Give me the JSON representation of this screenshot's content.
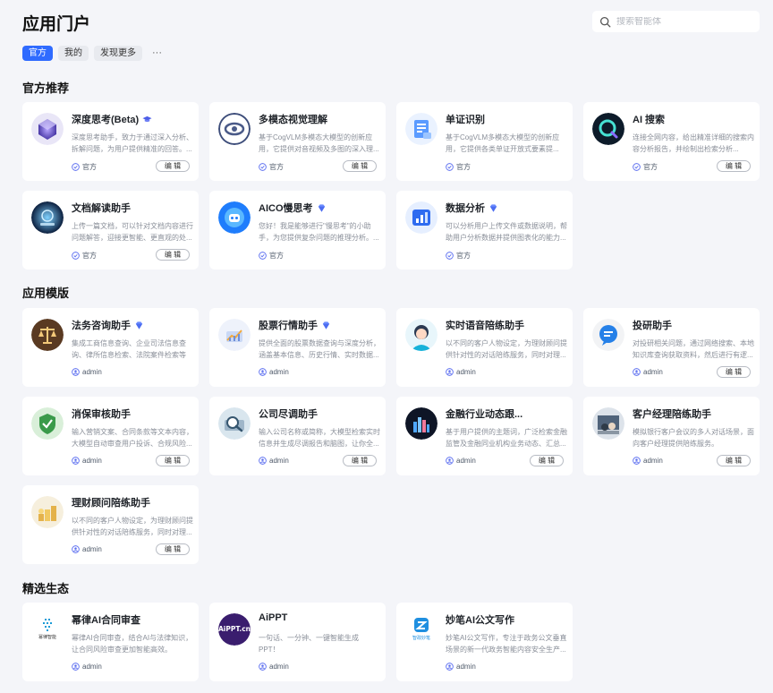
{
  "header": {
    "title": "应用门户",
    "search_placeholder": "搜索智能体"
  },
  "tabs": [
    {
      "label": "官方",
      "active": true
    },
    {
      "label": "我的",
      "active": false
    },
    {
      "label": "发现更多",
      "active": false
    }
  ],
  "tabs_more": "···",
  "sections": {
    "official": {
      "title": "官方推荐",
      "cards": [
        {
          "title": "深度思考(Beta)",
          "desc": "深度思考助手，致力于通过深入分析、拆解问题，为用户提供精准的回答。...",
          "owner": "官方",
          "edit": "编 辑",
          "badge": "cap"
        },
        {
          "title": "多模态视觉理解",
          "desc": "基于CogVLM多模态大模型的创新应用，它提供对音视频及多图的深入理...",
          "owner": "官方",
          "edit": "编 辑"
        },
        {
          "title": "单证识别",
          "desc": "基于CogVLM多模态大模型的创新应用，它提供各类单证开放式要素提...",
          "owner": "官方"
        },
        {
          "title": "AI 搜索",
          "desc": "连接全网内容，给出精准详细的搜索内容分析报告，并绘制出检索分析...",
          "owner": "官方",
          "edit": "编 辑"
        },
        {
          "title": "文档解读助手",
          "desc": "上传一篇文档，可以针对文档内容进行问题解答，迎接更智能、更直观的处...",
          "owner": "官方",
          "edit": "编 辑"
        },
        {
          "title": "AICO慢思考",
          "desc": "您好！我是能够进行\"慢思考\"的小助手，为您提供复杂问题的推理分析。...",
          "owner": "官方",
          "badge": "diamond"
        },
        {
          "title": "数据分析",
          "desc": "可以分析用户上传文件或数据说明，帮助用户分析数据并提供图表化的能力...",
          "owner": "官方",
          "badge": "diamond"
        }
      ]
    },
    "templates": {
      "title": "应用模版",
      "cards": [
        {
          "title": "法务咨询助手",
          "desc": "集成工商信息查询、企业司法信息查询、律所信息检索、法院案件检索等 ...",
          "owner": "admin",
          "badge": "diamond"
        },
        {
          "title": "股票行情助手",
          "desc": "提供全面的股票数据查询与深度分析，涵盖基本信息、历史行情、实时数据...",
          "owner": "admin",
          "badge": "diamond"
        },
        {
          "title": "实时语音陪练助手",
          "desc": "以不同的客户人物设定，为理财顾问提供针对性的对话陪练服务，同时对理...",
          "owner": "admin"
        },
        {
          "title": "投研助手",
          "desc": "对投研相关问题，通过网络搜索、本地知识库查询获取资料，然后进行有逻...",
          "owner": "admin",
          "edit": "编 辑"
        },
        {
          "title": "消保审核助手",
          "desc": "输入营销文案、合同条款等文本内容，大模型自动审查用户投诉、合规风险...",
          "owner": "admin",
          "edit": "编 辑"
        },
        {
          "title": "公司尽调助手",
          "desc": "输入公司名称或简称，大模型检索实时信息并生成尽调报告和脑图，让你全...",
          "owner": "admin",
          "edit": "编 辑"
        },
        {
          "title": "金融行业动态跟...",
          "desc": "基于用户提供的主题词，广泛检索金融监管及金融同业机构业务动态、汇总...",
          "owner": "admin",
          "edit": "编 辑"
        },
        {
          "title": "客户经理陪练助手",
          "desc": "模拟银行客户会议的多人对话场景，面向客户经理提供陪练服务。",
          "owner": "admin",
          "edit": "编 辑"
        },
        {
          "title": "理财顾问陪练助手",
          "desc": "以不同的客户人物设定，为理财顾问提供针对性的对话陪练服务，同时对理...",
          "owner": "admin",
          "edit": "编 辑"
        }
      ]
    },
    "ecosystem": {
      "title": "精选生态",
      "cards": [
        {
          "title": "幂律AI合同审查",
          "desc": "幂律AI合同审查，结合AI与法律知识，让合同风险审查更加智能高效。",
          "owner": "admin",
          "icon_text": "幂律智能"
        },
        {
          "title": "AiPPT",
          "desc": "一句话、一分钟、一键智能生成 PPT！",
          "owner": "admin",
          "icon_text": "AiPPT.cn"
        },
        {
          "title": "妙笔AI公文写作",
          "desc": "妙笔AI公文写作，专注于政务公文垂直场景的新一代政务智能内容安全生产...",
          "owner": "admin",
          "icon_text": "智政妙笔"
        }
      ]
    }
  },
  "colors": {
    "accent": "#2f6bff",
    "background": "#f4f5f9",
    "card": "#ffffff"
  }
}
